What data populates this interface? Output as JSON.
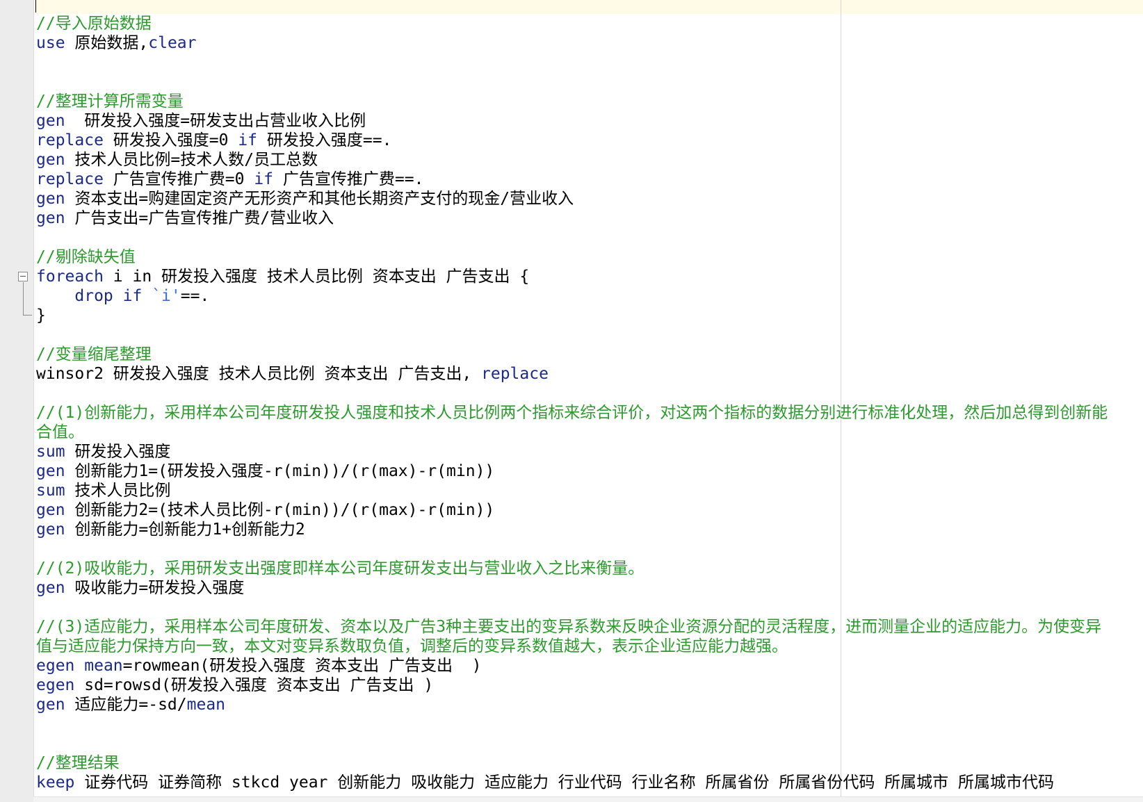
{
  "editor": {
    "language": "Stata do-file",
    "lines": [
      [
        {
          "t": "//导入原始数据",
          "c": "c"
        }
      ],
      [
        {
          "t": "use",
          "c": "k"
        },
        {
          "t": " 原始数据,",
          "c": ""
        },
        {
          "t": "clear",
          "c": "k"
        }
      ],
      [],
      [],
      [
        {
          "t": "//整理计算所需变量",
          "c": "c"
        }
      ],
      [
        {
          "t": "gen",
          "c": "k"
        },
        {
          "t": "  研发投入强度=研发支出占营业收入比例",
          "c": ""
        }
      ],
      [
        {
          "t": "replace",
          "c": "k"
        },
        {
          "t": " 研发投入强度=0 ",
          "c": ""
        },
        {
          "t": "if",
          "c": "k"
        },
        {
          "t": " 研发投入强度==.",
          "c": ""
        }
      ],
      [
        {
          "t": "gen",
          "c": "k"
        },
        {
          "t": " 技术人员比例=技术人数/员工总数",
          "c": ""
        }
      ],
      [
        {
          "t": "replace",
          "c": "k"
        },
        {
          "t": " 广告宣传推广费=0 ",
          "c": ""
        },
        {
          "t": "if",
          "c": "k"
        },
        {
          "t": " 广告宣传推广费==.",
          "c": ""
        }
      ],
      [
        {
          "t": "gen",
          "c": "k"
        },
        {
          "t": " 资本支出=购建固定资产无形资产和其他长期资产支付的现金/营业收入",
          "c": ""
        }
      ],
      [
        {
          "t": "gen",
          "c": "k"
        },
        {
          "t": " 广告支出=广告宣传推广费/营业收入",
          "c": ""
        }
      ],
      [],
      [
        {
          "t": "//剔除缺失值",
          "c": "c"
        }
      ],
      [
        {
          "t": "foreach",
          "c": "k"
        },
        {
          "t": " i in 研发投入强度 技术人员比例 资本支出 广告支出 {",
          "c": ""
        }
      ],
      [
        {
          "t": "    ",
          "c": ""
        },
        {
          "t": "drop if",
          "c": "k"
        },
        {
          "t": " ",
          "c": ""
        },
        {
          "t": "`i'",
          "c": "s"
        },
        {
          "t": "==.",
          "c": ""
        }
      ],
      [
        {
          "t": "}",
          "c": ""
        }
      ],
      [],
      [
        {
          "t": "//变量缩尾整理",
          "c": "c"
        }
      ],
      [
        {
          "t": "winsor2 研发投入强度 技术人员比例 资本支出 广告支出, ",
          "c": ""
        },
        {
          "t": "replace",
          "c": "k"
        }
      ],
      [],
      [
        {
          "t": "//(1)创新能力，采用样本公司年度研发投人强度和技术人员比例两个指标来综合评价，对这两个指标的数据分别进行标准化处理，然后加总得到创新能",
          "c": "c"
        }
      ],
      [
        {
          "t": "合值。",
          "c": "c"
        }
      ],
      [
        {
          "t": "sum",
          "c": "k"
        },
        {
          "t": " 研发投入强度",
          "c": ""
        }
      ],
      [
        {
          "t": "gen",
          "c": "k"
        },
        {
          "t": " 创新能力1=(研发投入强度-r(min))/(r(max)-r(min))",
          "c": ""
        }
      ],
      [
        {
          "t": "sum",
          "c": "k"
        },
        {
          "t": " 技术人员比例",
          "c": ""
        }
      ],
      [
        {
          "t": "gen",
          "c": "k"
        },
        {
          "t": " 创新能力2=(技术人员比例-r(min))/(r(max)-r(min))",
          "c": ""
        }
      ],
      [
        {
          "t": "gen",
          "c": "k"
        },
        {
          "t": " 创新能力=创新能力1+创新能力2",
          "c": ""
        }
      ],
      [],
      [
        {
          "t": "//(2)吸收能力，采用研发支出强度即样本公司年度研发支出与营业收入之比来衡量。",
          "c": "c"
        }
      ],
      [
        {
          "t": "gen",
          "c": "k"
        },
        {
          "t": " 吸收能力=研发投入强度",
          "c": ""
        }
      ],
      [],
      [
        {
          "t": "//(3)适应能力，采用样本公司年度研发、资本以及广告3种主要支出的变异系数来反映企业资源分配的灵活程度，进而测量企业的适应能力。为使变异",
          "c": "c"
        }
      ],
      [
        {
          "t": "值与适应能力保持方向一致，本文对变异系数取负值，调整后的变异系数值越大，表示企业适应能力越强。",
          "c": "c"
        }
      ],
      [
        {
          "t": "egen",
          "c": "k"
        },
        {
          "t": " ",
          "c": ""
        },
        {
          "t": "mean",
          "c": "k"
        },
        {
          "t": "=rowmean(研发投入强度 资本支出 广告支出  )",
          "c": ""
        }
      ],
      [
        {
          "t": "egen",
          "c": "k"
        },
        {
          "t": " sd=rowsd(研发投入强度 资本支出 广告支出 )",
          "c": ""
        }
      ],
      [
        {
          "t": "gen",
          "c": "k"
        },
        {
          "t": " 适应能力=-sd/",
          "c": ""
        },
        {
          "t": "mean",
          "c": "k"
        }
      ],
      [],
      [],
      [
        {
          "t": "//整理结果",
          "c": "c"
        }
      ],
      [
        {
          "t": "keep",
          "c": "k"
        },
        {
          "t": " 证券代码 证券简称 stkcd year 创新能力 吸收能力 适应能力 行业代码 行业名称 所属省份 所属省份代码 所属城市 所属城市代码",
          "c": ""
        }
      ]
    ]
  }
}
